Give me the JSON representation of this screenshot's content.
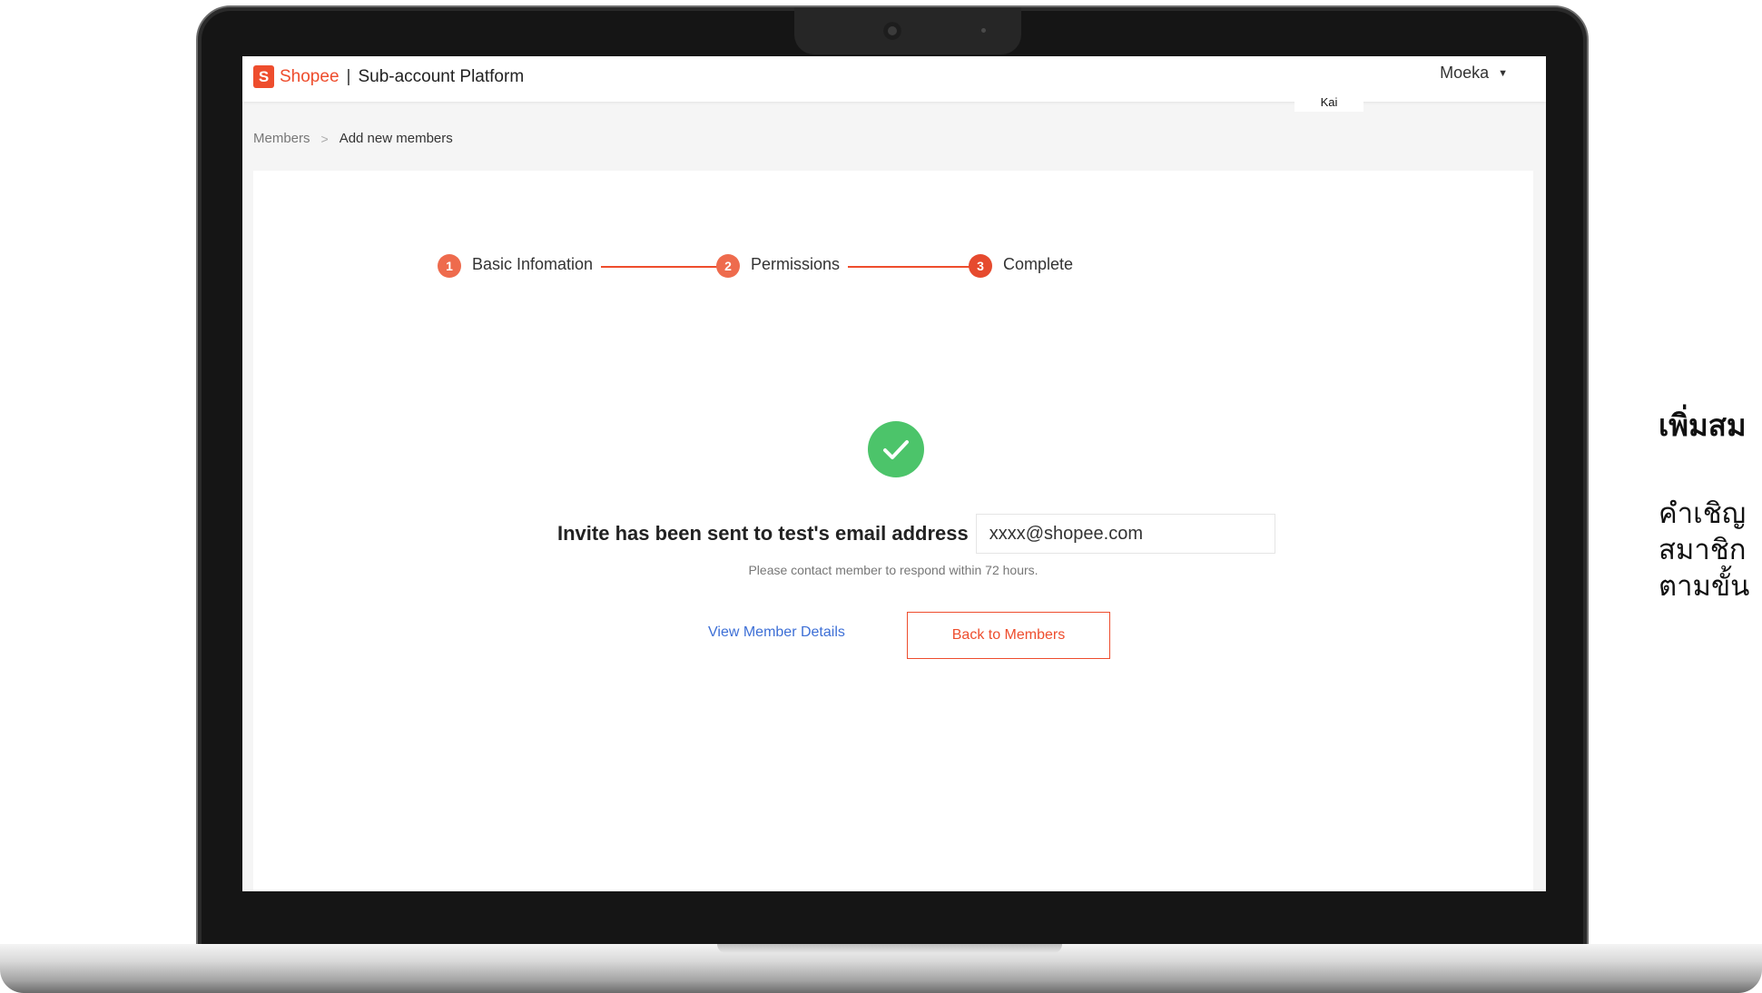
{
  "header": {
    "logo_icon": "S",
    "brand": "Shopee",
    "separator": "|",
    "platform_title": "Sub-account Platform",
    "user_name": "Moeka",
    "user_caret": "▼",
    "hover_tag": "Kai"
  },
  "breadcrumb": {
    "parent": "Members",
    "separator": ">",
    "current": "Add new members"
  },
  "stepper": [
    {
      "number": "1",
      "label": "Basic Infomation"
    },
    {
      "number": "2",
      "label": "Permissions"
    },
    {
      "number": "3",
      "label": "Complete"
    }
  ],
  "result": {
    "icon": "check-circle-icon",
    "message": "Invite has been sent to test's email address",
    "email_value": "xxxx@shopee.com",
    "notice": "Please contact member to respond within 72 hours.",
    "view_link": "View Member Details",
    "back_button": "Back to Members"
  },
  "side_panel": {
    "heading": "เพิ่มสม",
    "lines": [
      "คำเชิญ",
      "สมาชิก",
      "ตามขั้น"
    ]
  },
  "colors": {
    "accent": "#ee4d2d",
    "success": "#4cc46a",
    "link": "#3d6fd6"
  }
}
